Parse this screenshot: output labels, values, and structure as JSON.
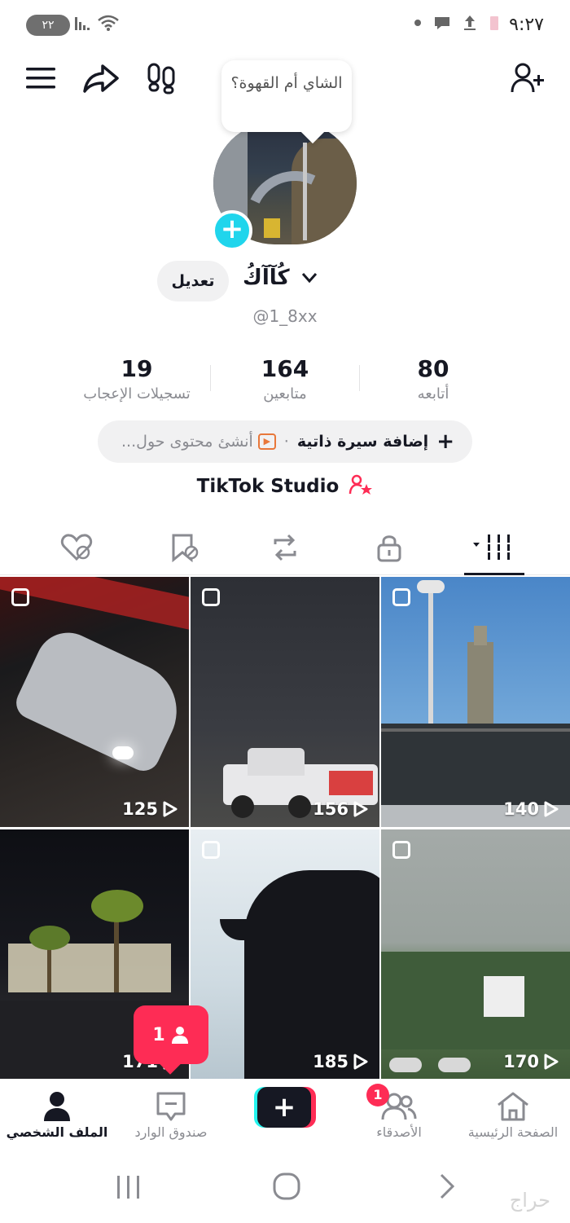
{
  "status_bar": {
    "time": "٩:٢٧",
    "battery_badge": "٢٢"
  },
  "top_nav": {
    "icons": [
      "menu-icon",
      "share-icon",
      "footprints-icon",
      "add-friend-icon"
    ]
  },
  "profile": {
    "note_bubble": "الشاي أم القهوة؟",
    "name": "ﮐُﺂآكُ",
    "username": "@1_8xx",
    "edit_label": "تعديل"
  },
  "stats": {
    "following": {
      "value": "80",
      "label": "أتابعه"
    },
    "followers": {
      "value": "164",
      "label": "متابعين"
    },
    "likes": {
      "value": "19",
      "label": "تسجيلات الإعجاب"
    }
  },
  "bio_pill": {
    "add_bio": "إضافة سيرة ذاتية",
    "separator": "·",
    "hint": "أنشئ محتوى حول..."
  },
  "studio_link": "TikTok Studio",
  "tabs": [
    "videos-tab",
    "private-tab",
    "reposts-tab",
    "favorites-tab",
    "liked-tab"
  ],
  "grid": [
    {
      "views": "125"
    },
    {
      "views": "156"
    },
    {
      "views": "140"
    },
    {
      "views": "171"
    },
    {
      "views": "185"
    },
    {
      "views": "170"
    }
  ],
  "notification_bubble": {
    "count": "1"
  },
  "bottom_nav": {
    "profile": "الملف الشخصي",
    "inbox": "صندوق الوارد",
    "friends": "الأصدقاء",
    "friends_badge": "1",
    "home": "الصفحة الرئيسية"
  },
  "watermark": "حراج",
  "colors": {
    "accent_red": "#fe2c55",
    "accent_cyan": "#25f4ee",
    "avatar_add": "#20d5ec",
    "text_primary": "#161823",
    "text_secondary": "#8a8b91"
  }
}
